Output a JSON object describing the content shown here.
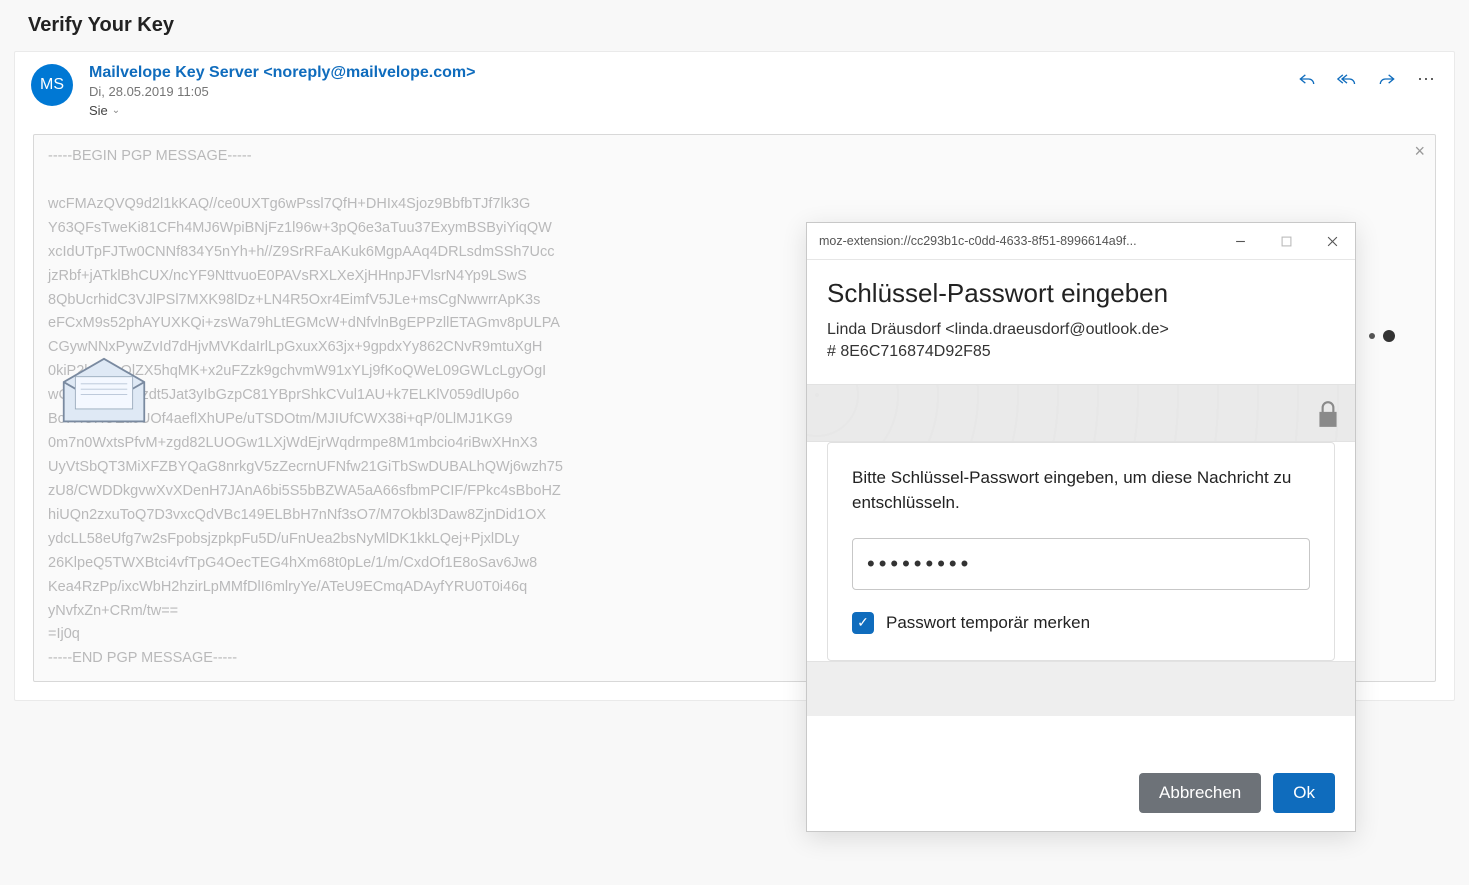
{
  "subject": "Verify Your Key",
  "avatar_initials": "MS",
  "sender": "Mailvelope Key Server <noreply@mailvelope.com>",
  "date": "Di, 28.05.2019 11:05",
  "recipients_label": "Sie",
  "actions": {
    "reply": "reply",
    "reply_all": "reply-all",
    "forward": "forward",
    "more": "⋯"
  },
  "pgp_begin": "-----BEGIN PGP MESSAGE-----",
  "pgp_body": "wcFMAzQVQ9d2l1kKAQ//ce0UXTg6wPssl7QfH+DHIx4Sjoz9BbfbTJf7lk3G\nY63QFsTweKi81CFh4MJ6WpiBNjFz1l96w+3pQ6e3aTuu37ExymBSByiYiqQW\nxcIdUTpFJTw0CNNf834Y5nYh+h//Z9SrRFaAKuk6MgpAAq4DRLsdmSSh7Ucc\njzRbf+jATklBhCUX/ncYF9NttvuoE0PAVsRXLXeXjHHnpJFVlsrN4Yp9LSwS\n8QbUcrhidC3VJlPSl7MXK98lDz+LN4R5Oxr4EimfV5JLe+msCgNwwrrApK3s\neFCxM9s52phAYUXKQi+zsWa79hLtEGMcW+dNfvlnBgEPPzllETAGmv8pULPA\nCGywNNxPywZvId7dHjvMVKdaIrlLpGxuxX63jx+9gpdxYy862CNvR9mtuXgH\n0kiP2bjKsaQlZX5hqMK+x2uFZzk9gchvmW91xYLj9fKoQWeL09GWLcLgyOgI\nwCPuYlfGvvlTzdt5Jat3yIbGzpC81YBprShkCVul1AU+k7ELKlV059dlUp6o\nBc7HUHUEuJUOf4aeflXhUPe/uTSDOtm/MJIUfCWX38i+qP/0LlMJ1KG9\n0m7n0WxtsPfvM+zgd82LUOGw1LXjWdEjrWqdrmpe8M1mbcio4riBwXHnX3\nUyVtSbQT3MiXFZBYQaG8nrkgV5zZecrnUFNfw21GiTbSwDUBALhQWj6wzh75\nzU8/CWDDkgvwXvXDenH7JAnA6bi5S5bBZWA5aA66sfbmPCIF/FPkc4sBboHZ\nhiUQn2zxuToQ7D3vxcQdVBc149ELBbH7nNf3sO7/M7Okbl3Daw8ZjnDid1OX\nydcLL58eUfg7w2sFpobsjzpkpFu5D/uFnUea2bsNyMlDK1kkLQej+PjxlDLy\n26KlpeQ5TWXBtci4vfTpG4OecTEG4hXm68t0pLe/1/m/CxdOf1E8oSav6Jw8\nKea4RzPp/ixcWbH2hzirLpMMfDlI6mlryYe/ATeU9ECmqADAyfYRU0T0i46q\nyNvfxZn+CRm/tw==\n=Ij0q",
  "pgp_end": "-----END PGP MESSAGE-----",
  "popup": {
    "address": "moz-extension://cc293b1c-c0dd-4633-8f51-8996614a9f...",
    "title": "Schlüssel-Passwort eingeben",
    "identity": "Linda Dräusdorf <linda.draeusdorf@outlook.de>",
    "key_id": "# 8E6C716874D92F85",
    "prompt": "Bitte Schlüssel-Passwort eingeben, um diese Nachricht zu entschlüsseln.",
    "password_value": "•••••••••",
    "remember_label": "Passwort temporär merken",
    "remember_checked": true,
    "cancel_label": "Abbrechen",
    "ok_label": "Ok"
  }
}
